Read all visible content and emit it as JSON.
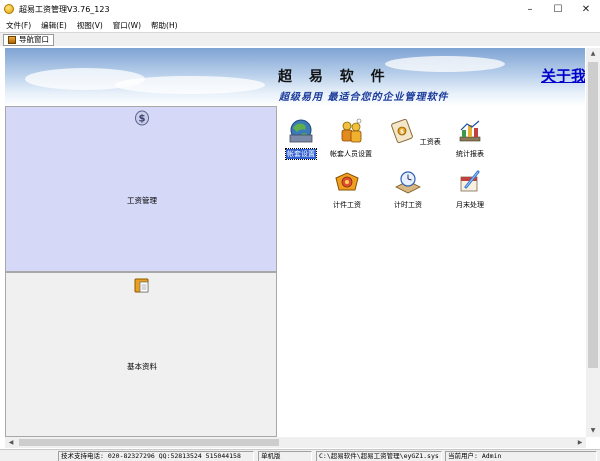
{
  "window": {
    "title": "超易工资管理V3.76_123",
    "minimize_glyph": "–",
    "maximize_glyph": "☐",
    "close_glyph": "✕"
  },
  "menu": [
    {
      "label": "文件(F)"
    },
    {
      "label": "编辑(E)"
    },
    {
      "label": "视图(V)"
    },
    {
      "label": "窗口(W)"
    },
    {
      "label": "帮助(H)"
    }
  ],
  "nav_tab": {
    "label": "导航窗口"
  },
  "banner": {
    "title": "超 易 软 件",
    "about": "关于我",
    "slogan": "超级易用  最适合您的企业管理软件"
  },
  "nav_sections": [
    {
      "label": "工资管理",
      "icon": "dollar-coin-icon",
      "active": true
    },
    {
      "label": "基本资料",
      "icon": "folder-document-icon",
      "active": false
    }
  ],
  "functions": [
    {
      "label": "帐套设置",
      "icon": "account-set-icon",
      "selected": true
    },
    {
      "label": "帐套人员设置",
      "icon": "account-staff-icon",
      "selected": false
    },
    {
      "label": "工资表",
      "icon": "payroll-sheet-icon",
      "selected": false
    },
    {
      "label": "统计报表",
      "icon": "statistics-report-icon",
      "selected": false
    },
    {
      "label": "计件工资",
      "icon": "piece-wage-icon",
      "selected": false
    },
    {
      "label": "计时工资",
      "icon": "hourly-wage-icon",
      "selected": false
    },
    {
      "label": "月末处理",
      "icon": "month-end-icon",
      "selected": false
    }
  ],
  "statusbar": {
    "support": "技术支持电话: 020-82327296 QQ:52813524 515044158",
    "mode": "单机版",
    "path": "C:\\超易软件\\超易工资管理\\eyGZ1.sys",
    "user": "当前用户: Admin"
  },
  "colors": {
    "nav_active_bg": "#d6d8f8",
    "nav_inactive_bg": "#f0f0f0",
    "banner_title": "#111111",
    "banner_about": "#0000cc",
    "banner_slogan": "#1c3c9c",
    "selection": "#2f5fd0"
  }
}
